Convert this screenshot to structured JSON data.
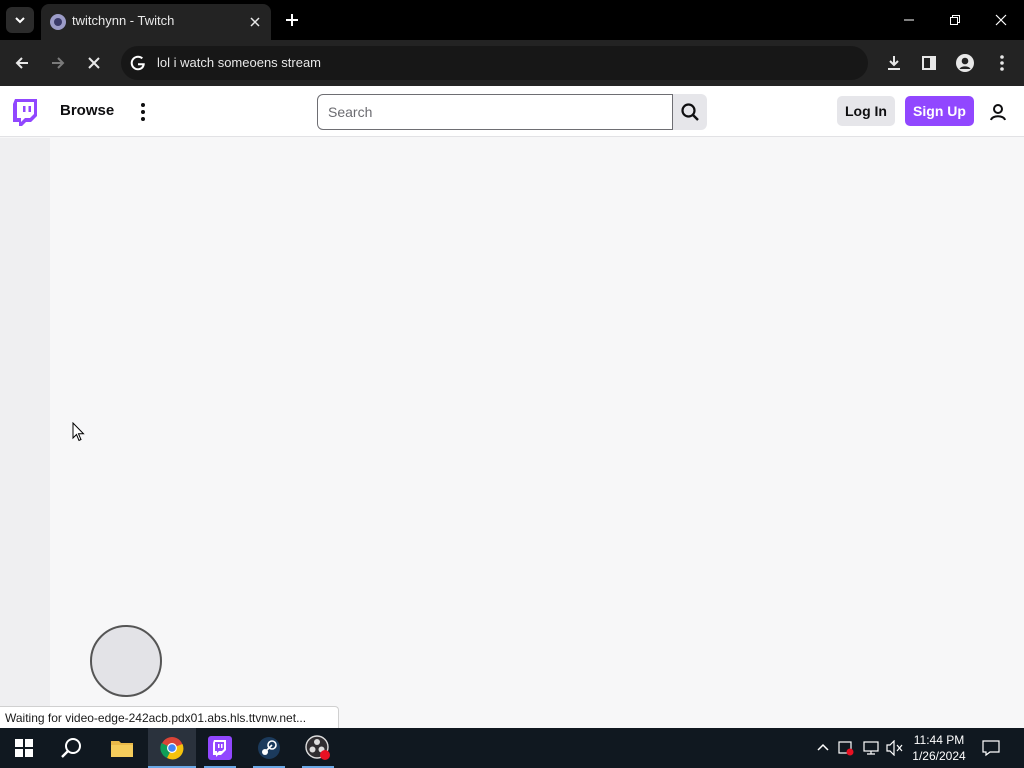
{
  "browser": {
    "tab_title": "twitchynn - Twitch",
    "omnibox_text": "lol i watch someoens stream",
    "status_text": "Waiting for video-edge-242acb.pdx01.abs.hls.ttvnw.net..."
  },
  "twitch": {
    "browse_label": "Browse",
    "search_placeholder": "Search",
    "login_label": "Log In",
    "signup_label": "Sign Up",
    "brand_color": "#9147ff"
  },
  "taskbar": {
    "time": "11:44 PM",
    "date": "1/26/2024",
    "apps": [
      "start-icon",
      "search-icon",
      "file-explorer-icon",
      "chrome-icon",
      "twitch-icon",
      "steam-icon",
      "obs-icon"
    ]
  }
}
